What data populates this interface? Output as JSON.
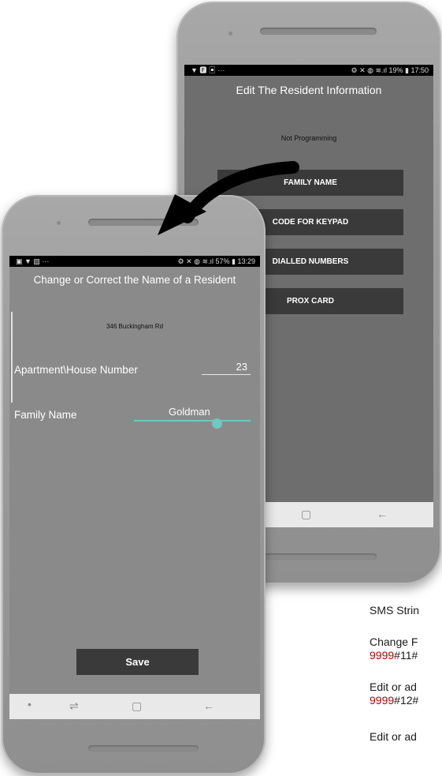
{
  "back_phone": {
    "status_left": "▼ 🅵 ▣  ···",
    "status_right": "⚙ ✕ ◍ ≋.ıl 19% ▮ 17:50",
    "title": "Edit The Resident Information",
    "subtitle": "Not Programming",
    "menu": [
      "FAMILY NAME",
      "CODE FOR KEYPAD",
      "DIALLED NUMBERS",
      "PROX CARD"
    ],
    "nav_square": "▢",
    "nav_back": "←"
  },
  "front_phone": {
    "status_left": "▣ ▼ ▧  ···",
    "status_right": "⚙ ✕ ◍ ≋.ıl 57% ▮ 13:29",
    "title": "Change or Correct the Name of a Resident",
    "address": "346 Buckingham Rd",
    "apartment_label": "Apartment\\House Number",
    "apartment_value": "23",
    "family_label": "Family Name",
    "family_value": "Goldman",
    "save_label": "Save",
    "nav_dot": "•",
    "nav_recent": "⇌",
    "nav_square": "▢",
    "nav_back": "←"
  },
  "side_text": {
    "line1": "SMS Strin",
    "line2": "Change F",
    "line3_red": "9999",
    "line3_rest": "#11#",
    "line4": "Edit or ad",
    "line5_red": "9999",
    "line5_rest": "#12#",
    "line6": "Edit or ad"
  },
  "colors": {
    "accent": "#6ec9c0",
    "button": "#3a3a3a",
    "red_text": "#c00000"
  }
}
